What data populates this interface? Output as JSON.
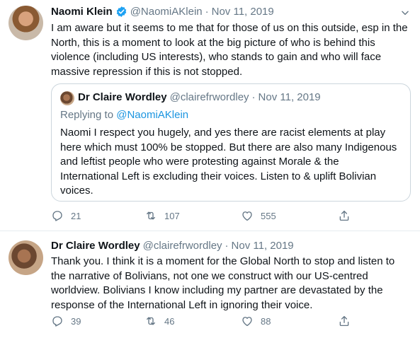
{
  "tweets": [
    {
      "author": {
        "name": "Naomi Klein",
        "handle": "@NaomiAKlein",
        "verified": true
      },
      "date": "Nov 11, 2019",
      "text": "I am aware but it seems to me that for those of us on this outside, esp in the North, this is a moment to look at the big picture of who is behind this violence (including US interests), who stands to gain and who will face massive repression if this is not stopped.",
      "quoted": {
        "author": {
          "name": "Dr Claire Wordley",
          "handle": "@clairefrwordley"
        },
        "date": "Nov 11, 2019",
        "replying_prefix": "Replying to",
        "replying_to": "@NaomiAKlein",
        "text": "Naomi I respect you hugely, and yes there are racist elements at play here which must 100% be stopped. But there are also many Indigenous and leftist people who were protesting against Morale & the International Left is excluding their voices. Listen to & uplift Bolivian voices."
      },
      "stats": {
        "replies": "21",
        "retweets": "107",
        "likes": "555"
      }
    },
    {
      "author": {
        "name": "Dr Claire Wordley",
        "handle": "@clairefrwordley",
        "verified": false
      },
      "date": "Nov 11, 2019",
      "text": "Thank you. I think it is a moment for the Global North to stop and listen to the narrative of Bolivians, not one we construct with our US-centred worldview. Bolivians I know including my partner are devastated by the response of the International Left in ignoring their voice.",
      "stats": {
        "replies": "39",
        "retweets": "46",
        "likes": "88"
      }
    }
  ],
  "separator": "·",
  "colors": {
    "accent": "#1da1f2",
    "text": "#0f1419",
    "secondary": "#657786",
    "border": "#ccd6dd"
  },
  "icons": [
    "verified-badge-icon",
    "chevron-down-icon",
    "reply-icon",
    "retweet-icon",
    "like-icon",
    "share-icon"
  ]
}
